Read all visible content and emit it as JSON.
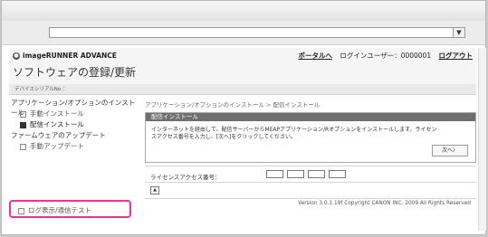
{
  "address_bar": {
    "value": ""
  },
  "header": {
    "brand": "imageRUNNER ADVANCE",
    "portal_link": "ポータルへ",
    "login_user_label": "ログインユーザー：",
    "login_user_value": "0000001",
    "logout": "ログアウト",
    "page_title": "ソフトウェアの登録/更新"
  },
  "subbar": {
    "text": "デバイスシリアルNo.："
  },
  "sidebar": {
    "section1": "アプリケーション/オプションのインストール",
    "item_manual_install": "手動インストール",
    "item_distribution_install": "配信インストール",
    "section2": "ファームウェアのアップデート",
    "item_manual_update": "手動アップデート",
    "item_log_test": "ログ表示/通信テスト"
  },
  "main": {
    "breadcrumb": "アプリケーション/オプションのインストール > 配信インストール",
    "panel_title": "配信インストール",
    "panel_text": "インターネットを経由して、配信サーバーからMEAPアプリケーション/Rオプションをインストールします。ライセンスアクセス番号を入力し、[次へ]をクリックしてください。",
    "next_button": "次へ〉",
    "license_label": "ライセンスアクセス番号："
  },
  "footer": {
    "text": "Version 3.0.1.19f Copyright CANON INC. 2009 All Rights Reserved"
  }
}
